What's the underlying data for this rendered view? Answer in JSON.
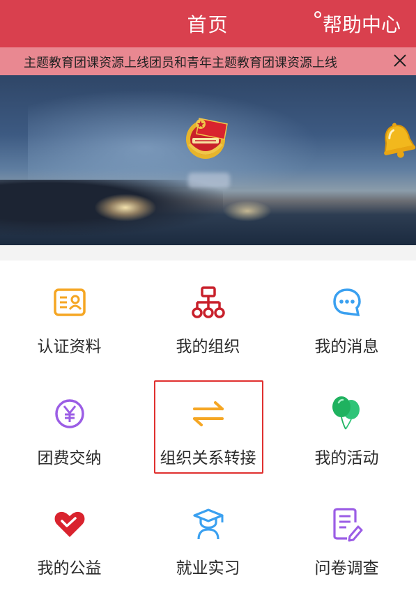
{
  "header": {
    "title": "首页",
    "help_label": "帮助中心"
  },
  "ticker": {
    "text": "主题教育团课资源上线团员和青年主题教育团课资源上线",
    "close_icon": "close-icon"
  },
  "banner": {
    "emblem_icon": "communist-youth-league-emblem",
    "bell_icon": "bell-icon"
  },
  "menu": {
    "items": [
      {
        "label": "认证资料",
        "icon": "id-card-icon",
        "color": "#f5a623"
      },
      {
        "label": "我的组织",
        "icon": "org-tree-icon",
        "color": "#c8202b"
      },
      {
        "label": "我的消息",
        "icon": "chat-bubble-icon",
        "color": "#3aa0f0"
      },
      {
        "label": "团费交纳",
        "icon": "yuan-coin-icon",
        "color": "#9b5de5"
      },
      {
        "label": "组织关系转接",
        "icon": "transfer-arrows-icon",
        "color": "#f5a623"
      },
      {
        "label": "我的活动",
        "icon": "balloons-icon",
        "color": "#23c16b"
      },
      {
        "label": "我的公益",
        "icon": "heart-hand-icon",
        "color": "#d9232e"
      },
      {
        "label": "就业实习",
        "icon": "graduate-icon",
        "color": "#3aa0f0"
      },
      {
        "label": "问卷调查",
        "icon": "survey-edit-icon",
        "color": "#9b5de5"
      }
    ]
  },
  "colors": {
    "header_bg": "#d9404e",
    "ticker_bg": "#e98891",
    "highlight_border": "#e0302f"
  }
}
